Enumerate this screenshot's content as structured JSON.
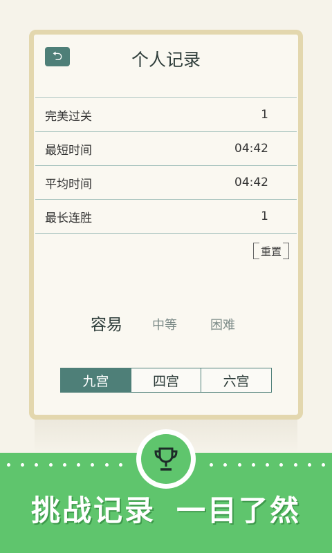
{
  "header": {
    "title": "个人记录",
    "back_icon": "back-arrow-icon"
  },
  "stats": [
    {
      "label": "完美过关",
      "value": "1"
    },
    {
      "label": "最短时间",
      "value": "04:42"
    },
    {
      "label": "平均时间",
      "value": "04:42"
    },
    {
      "label": "最长连胜",
      "value": "1"
    }
  ],
  "reset_label": "重置",
  "difficulty": {
    "options": [
      "容易",
      "中等",
      "困难"
    ],
    "selected": "容易"
  },
  "grid_size": {
    "options": [
      "九宫",
      "四宫",
      "六宫"
    ],
    "selected": "九宫"
  },
  "banner": {
    "slogan_part1": "挑战记录",
    "slogan_part2": "一目了然",
    "icon": "trophy-icon"
  },
  "colors": {
    "accent": "#4e7f78",
    "banner": "#5fc56d",
    "card_border": "#e3d7ae"
  }
}
